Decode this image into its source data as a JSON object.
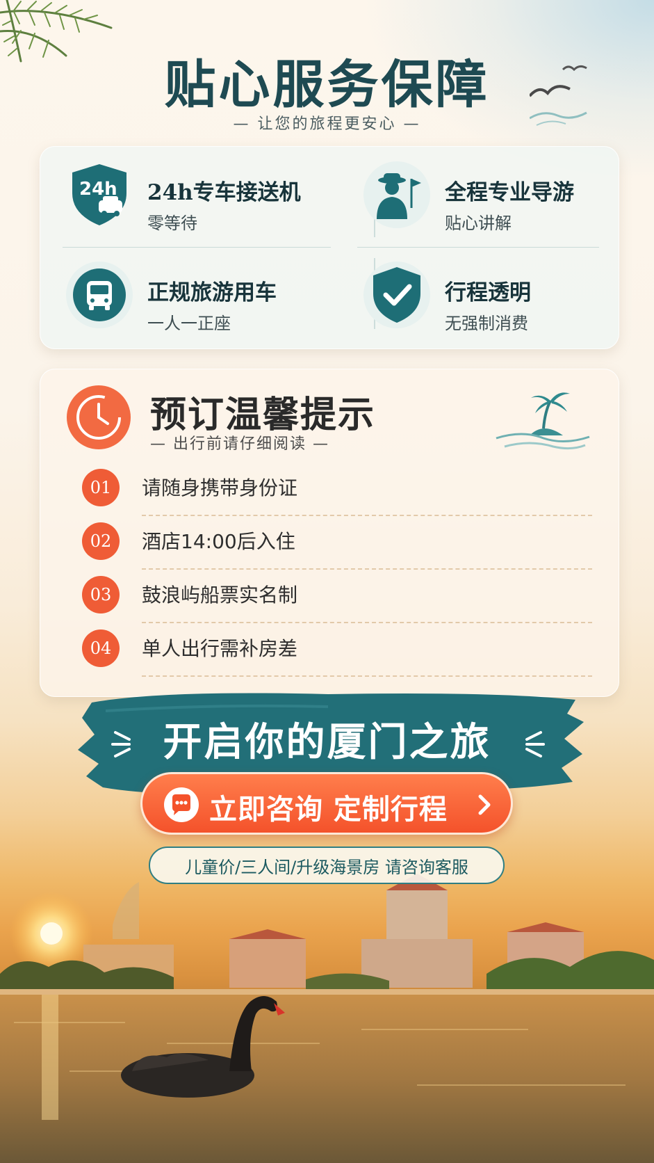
{
  "header": {
    "title": "贴心服务保障",
    "subtitle": "— 让您的旅程更安心 —"
  },
  "services": [
    {
      "title": "24h专车接送机",
      "subtitle": "零等待",
      "icon": "shield-car-icon",
      "badge": "24h"
    },
    {
      "title": "全程专业导游",
      "subtitle": "贴心讲解",
      "icon": "tour-guide-icon"
    },
    {
      "title": "正规旅游用车",
      "subtitle": "一人一正座",
      "icon": "bus-icon"
    },
    {
      "title": "行程透明",
      "subtitle": "无强制消费",
      "icon": "shield-check-icon"
    }
  ],
  "tips": {
    "title": "预订温馨提示",
    "subtitle": "— 出行前请仔细阅读 —",
    "items": [
      {
        "num": "01",
        "text": "请随身携带身份证"
      },
      {
        "num": "02",
        "text": "酒店14:00后入住"
      },
      {
        "num": "03",
        "text": "鼓浪屿船票实名制"
      },
      {
        "num": "04",
        "text": "单人出行需补房差"
      }
    ]
  },
  "cta": {
    "banner": "开启你的厦门之旅",
    "button_label": "立即咨询 定制行程",
    "note": "儿童价/三人间/升级海景房 请咨询客服"
  },
  "colors": {
    "teal": "#1e6e76",
    "orange": "#f4522b",
    "title": "#1e4a52"
  }
}
